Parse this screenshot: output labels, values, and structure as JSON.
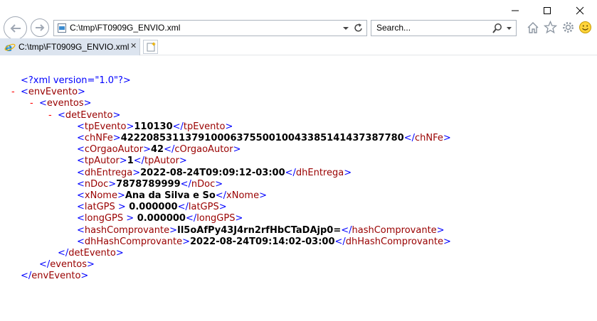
{
  "window": {
    "minimize_glyph": "—",
    "maximize_glyph": "☐",
    "close_glyph": "✕"
  },
  "navbar": {
    "address": "C:\\tmp\\FT0909G_ENVIO.xml",
    "search_placeholder": "Search...",
    "icons": [
      "back-icon",
      "forward-icon",
      "page-icon",
      "dropdown-icon",
      "refresh-icon",
      "search-icon",
      "home-icon",
      "favorites-star-icon",
      "settings-gear-icon",
      "feedback-smiley-icon"
    ]
  },
  "tab": {
    "title": "C:\\tmp\\FT0909G_ENVIO.xml",
    "close_glyph": "✕"
  },
  "xml": {
    "declaration": "<?xml version=\"1.0\"?>",
    "collapse_glyph": "-",
    "root": "envEvento",
    "eventos": "eventos",
    "detEvento": "detEvento",
    "fields": [
      {
        "tag": "tpEvento",
        "value": "110130"
      },
      {
        "tag": "chNFe",
        "value": "42220853113791000637550010043385141437387780"
      },
      {
        "tag": "cOrgaoAutor",
        "value": "42"
      },
      {
        "tag": "tpAutor",
        "value": "1"
      },
      {
        "tag": "dhEntrega",
        "value": "2022-08-24T09:09:12-03:00"
      },
      {
        "tag": "nDoc",
        "value": "7878789999"
      },
      {
        "tag": "xNome",
        "value": "Ana da Silva e So"
      },
      {
        "tag": "latGPS",
        "value": " 0.000000",
        "tag_suffix": " "
      },
      {
        "tag": "longGPS",
        "value": " 0.000000",
        "tag_suffix": " "
      },
      {
        "tag": "hashComprovante",
        "value": "Il5oAfPy43J4rn2rfHbCTaDAjp0="
      },
      {
        "tag": "dhHashComprovante",
        "value": "2022-08-24T09:14:02-03:00"
      }
    ]
  }
}
